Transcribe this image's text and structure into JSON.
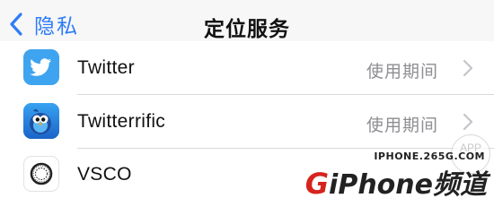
{
  "navbar": {
    "back_label": "隐私",
    "title": "定位服务"
  },
  "rows": [
    {
      "name": "Twitter",
      "value": "使用期间",
      "icon": "twitter-bird-icon"
    },
    {
      "name": "Twitterrific",
      "value": "使用期间",
      "icon": "twitterrific-bird-icon"
    },
    {
      "name": "VSCO",
      "value": "",
      "icon": "vsco-ring-icon"
    }
  ],
  "watermark": {
    "badge": "APP",
    "url": "IPHONE.265G.COM",
    "brand_prefix": "G",
    "brand_rest": "iPhone频道"
  },
  "colors": {
    "accent": "#2f7cf6",
    "twitter_blue": "#3fa4ef",
    "twitterrific_bg": "#1e78d9",
    "secondary_text": "#8e8e93"
  }
}
